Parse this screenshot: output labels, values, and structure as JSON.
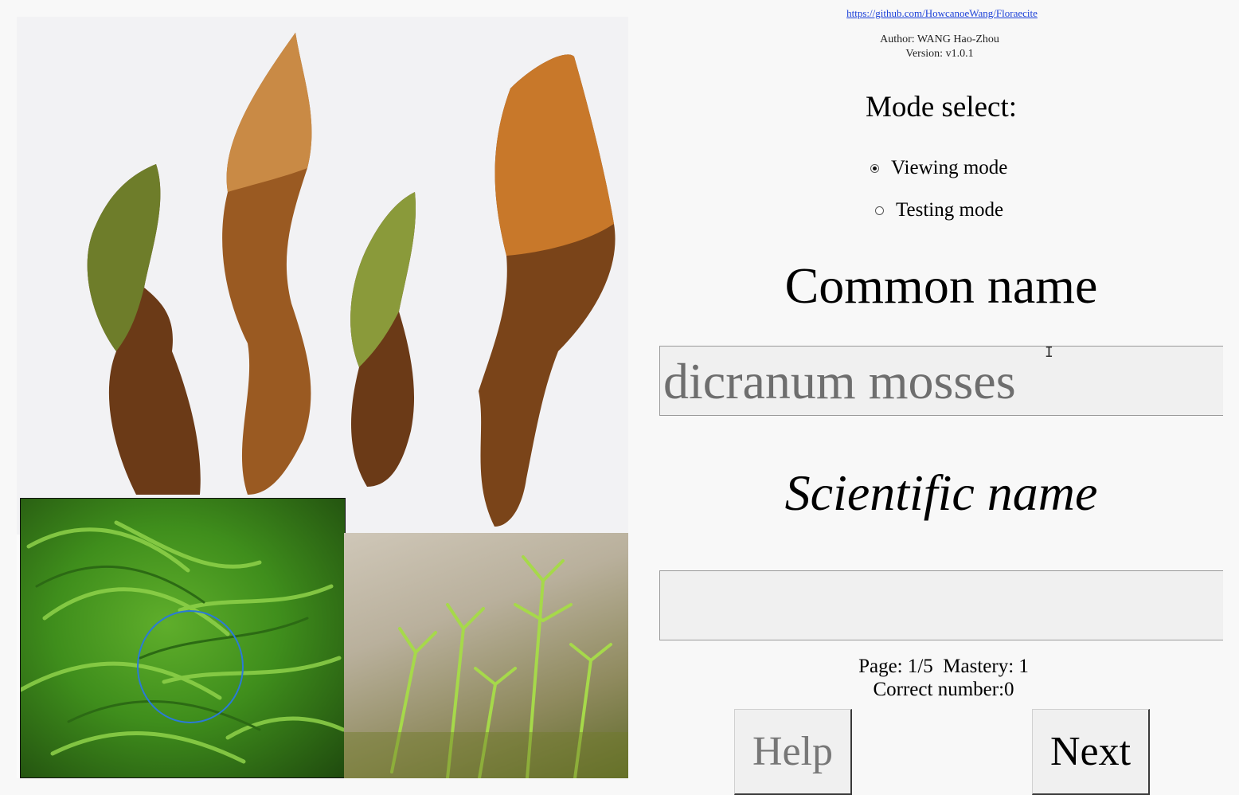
{
  "repo_link": "https://github.com/HowcanoeWang/Floraecite",
  "author": "Author: WANG Hao-Zhou",
  "version": "Version: v1.0.1",
  "mode_title": "Mode select:",
  "modes": [
    {
      "label": "Viewing mode",
      "selected": true
    },
    {
      "label": "Testing mode",
      "selected": false
    }
  ],
  "common_name_heading": "Common name",
  "common_name_value": "dicranum mosses",
  "scientific_name_heading": "Scientific name",
  "scientific_name_value": "",
  "status": {
    "page_line": "Page: 1/5  Mastery: 1",
    "correct_line": "Correct number:0"
  },
  "buttons": {
    "help": "Help",
    "next": "Next"
  },
  "colors": {
    "link": "#1a3fd8",
    "focus_ring": "#2a7ad8",
    "entry_bg": "#f0f0f0",
    "entry_text": "#6e6e6e"
  }
}
